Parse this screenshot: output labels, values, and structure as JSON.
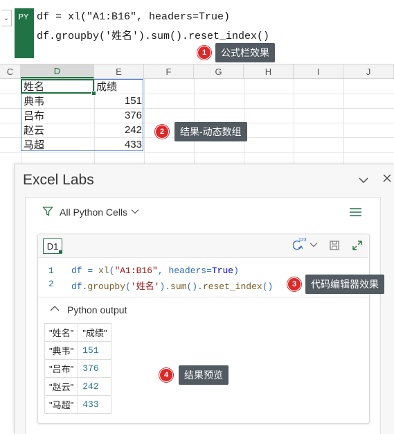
{
  "formula_bar": {
    "badge": "PY",
    "chevron": "⌄",
    "line1": "df = xl(\"A1:B16\", headers=True)",
    "line2": "df.groupby('姓名').sum().reset_index()"
  },
  "callouts": [
    {
      "num": "1",
      "label": "公式栏效果"
    },
    {
      "num": "2",
      "label": "结果-动态数组"
    },
    {
      "num": "3",
      "label": "代码编辑器效果"
    },
    {
      "num": "4",
      "label": "结果预览"
    }
  ],
  "grid": {
    "columns": [
      "C",
      "D",
      "E",
      "F",
      "G",
      "H",
      "I",
      "J"
    ],
    "header_row": [
      "姓名",
      "成绩"
    ],
    "rows": [
      {
        "name": "典韦",
        "score": "151"
      },
      {
        "name": "吕布",
        "score": "376"
      },
      {
        "name": "赵云",
        "score": "242"
      },
      {
        "name": "马超",
        "score": "433"
      }
    ]
  },
  "labs": {
    "title": "Excel Labs",
    "filter_label": "All Python Cells",
    "cell_ref": "D1",
    "ctrl_sup": "123",
    "editor": {
      "line_numbers": [
        "1",
        "2"
      ],
      "l1_a": "df = ",
      "l1_fn": "xl",
      "l1_b": "(",
      "l1_str": "\"A1:B16\"",
      "l1_c": ", headers=",
      "l1_kw": "True",
      "l1_d": ")",
      "l2_a": "df.",
      "l2_fn": "groupby",
      "l2_b": "(",
      "l2_str": "'姓名'",
      "l2_c": ").",
      "l2_fn2": "sum",
      "l2_d": "().",
      "l2_fn3": "reset_index",
      "l2_e": "()"
    },
    "output_label": "Python output",
    "preview": {
      "headers": [
        "\"姓名\"",
        "\"成绩\""
      ],
      "rows": [
        [
          "\"典韦\"",
          "151"
        ],
        [
          "\"吕布\"",
          "376"
        ],
        [
          "\"赵云\"",
          "242"
        ],
        [
          "\"马超\"",
          "433"
        ]
      ]
    }
  },
  "colors": {
    "excel_green": "#217346",
    "callout_red": "#e02727",
    "callout_bg": "#525a62",
    "spill_blue": "#4a7fd6"
  }
}
